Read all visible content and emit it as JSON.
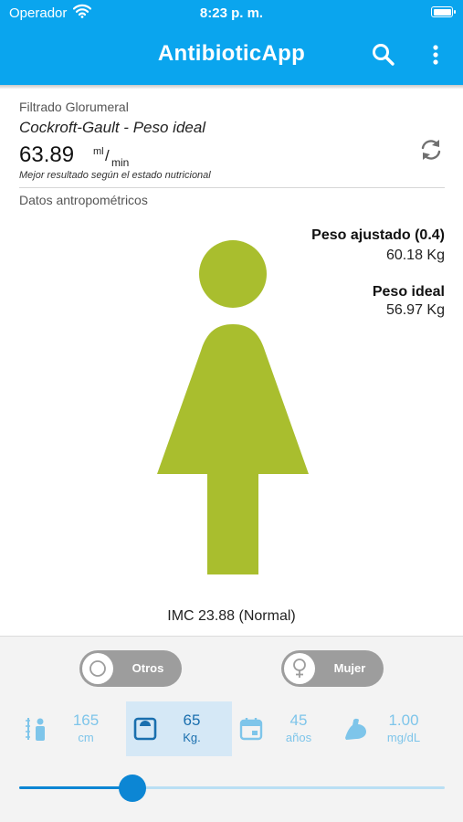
{
  "status_bar": {
    "carrier": "Operador",
    "time": "8:23 p. m."
  },
  "app_bar": {
    "title": "AntibioticApp",
    "actions": [
      "search-icon",
      "more-vertical-icon"
    ]
  },
  "result": {
    "section": "Filtrado Glorumeral",
    "formula": "Cockroft-Gault - Peso ideal",
    "value": "63.89",
    "unit_numerator": "ml",
    "unit_slash": "/",
    "unit_denominator": "min",
    "note": "Mejor resultado según el estado nutricional"
  },
  "anthropometric": {
    "section": "Datos antropométricos",
    "adjusted_weight_label": "Peso ajustado (0.4)",
    "adjusted_weight_value": "60.18 Kg",
    "ideal_weight_label": "Peso ideal",
    "ideal_weight_value": "56.97 Kg",
    "bmi": "IMC 23.88 (Normal)",
    "figure_color": "#a9be2e"
  },
  "controls": {
    "profile_toggle": "Otros",
    "sex_toggle": "Mujer",
    "params": [
      {
        "value": "165",
        "unit": "cm",
        "icon": "height-icon"
      },
      {
        "value": "65",
        "unit": "Kg.",
        "icon": "scale-icon",
        "selected": true
      },
      {
        "value": "45",
        "unit": "años",
        "icon": "calendar-icon"
      },
      {
        "value": "1.00",
        "unit": "mg/dL",
        "icon": "muscle-arm-icon"
      }
    ]
  },
  "colors": {
    "accent": "#0aa5ee",
    "slider": "#0c86d4",
    "param_text": "#7ec5ea"
  }
}
